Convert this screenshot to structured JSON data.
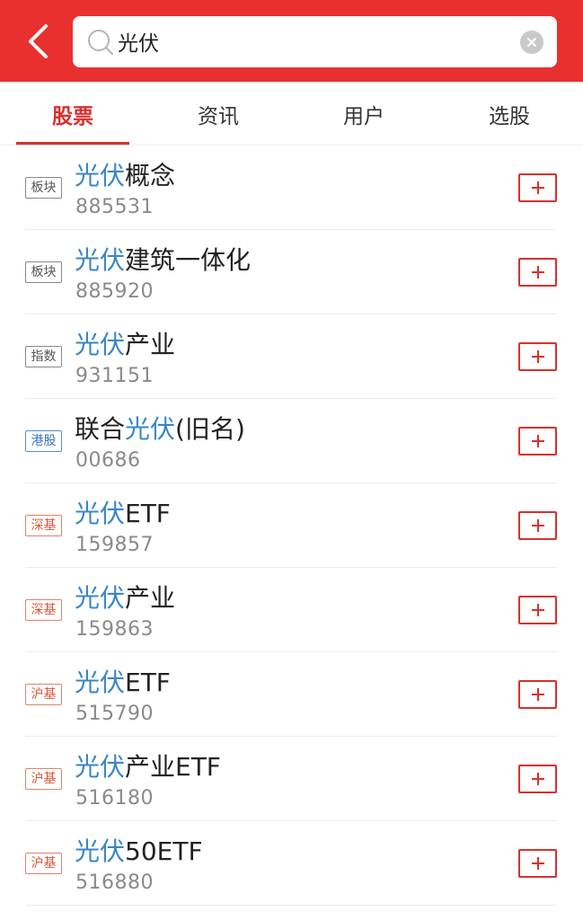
{
  "header": {
    "back_icon": "chevron-left-icon",
    "search": {
      "value": "光伏",
      "placeholder": ""
    },
    "accent_color": "#e8312f"
  },
  "tabs": [
    {
      "label": "股票",
      "active": true
    },
    {
      "label": "资讯",
      "active": false
    },
    {
      "label": "用户",
      "active": false
    },
    {
      "label": "选股",
      "active": false
    }
  ],
  "results": [
    {
      "badge": "板块",
      "badge_type": "sector",
      "highlight_prefix": "",
      "highlight": "光伏",
      "rest": "概念",
      "code": "885531"
    },
    {
      "badge": "板块",
      "badge_type": "sector",
      "highlight_prefix": "",
      "highlight": "光伏",
      "rest": "建筑一体化",
      "code": "885920"
    },
    {
      "badge": "指数",
      "badge_type": "index",
      "highlight_prefix": "",
      "highlight": "光伏",
      "rest": "产业",
      "code": "931151"
    },
    {
      "badge": "港股",
      "badge_type": "hk",
      "highlight_prefix": "联合",
      "highlight": "光伏",
      "rest": "(旧名)",
      "code": "00686"
    },
    {
      "badge": "深基",
      "badge_type": "fund",
      "highlight_prefix": "",
      "highlight": "光伏",
      "rest": "ETF",
      "code": "159857"
    },
    {
      "badge": "深基",
      "badge_type": "fund",
      "highlight_prefix": "",
      "highlight": "光伏",
      "rest": "产业",
      "code": "159863"
    },
    {
      "badge": "沪基",
      "badge_type": "fund",
      "highlight_prefix": "",
      "highlight": "光伏",
      "rest": "ETF",
      "code": "515790"
    },
    {
      "badge": "沪基",
      "badge_type": "fund",
      "highlight_prefix": "",
      "highlight": "光伏",
      "rest": "产业ETF",
      "code": "516180"
    },
    {
      "badge": "沪基",
      "badge_type": "fund",
      "highlight_prefix": "",
      "highlight": "光伏",
      "rest": "50ETF",
      "code": "516880"
    }
  ]
}
